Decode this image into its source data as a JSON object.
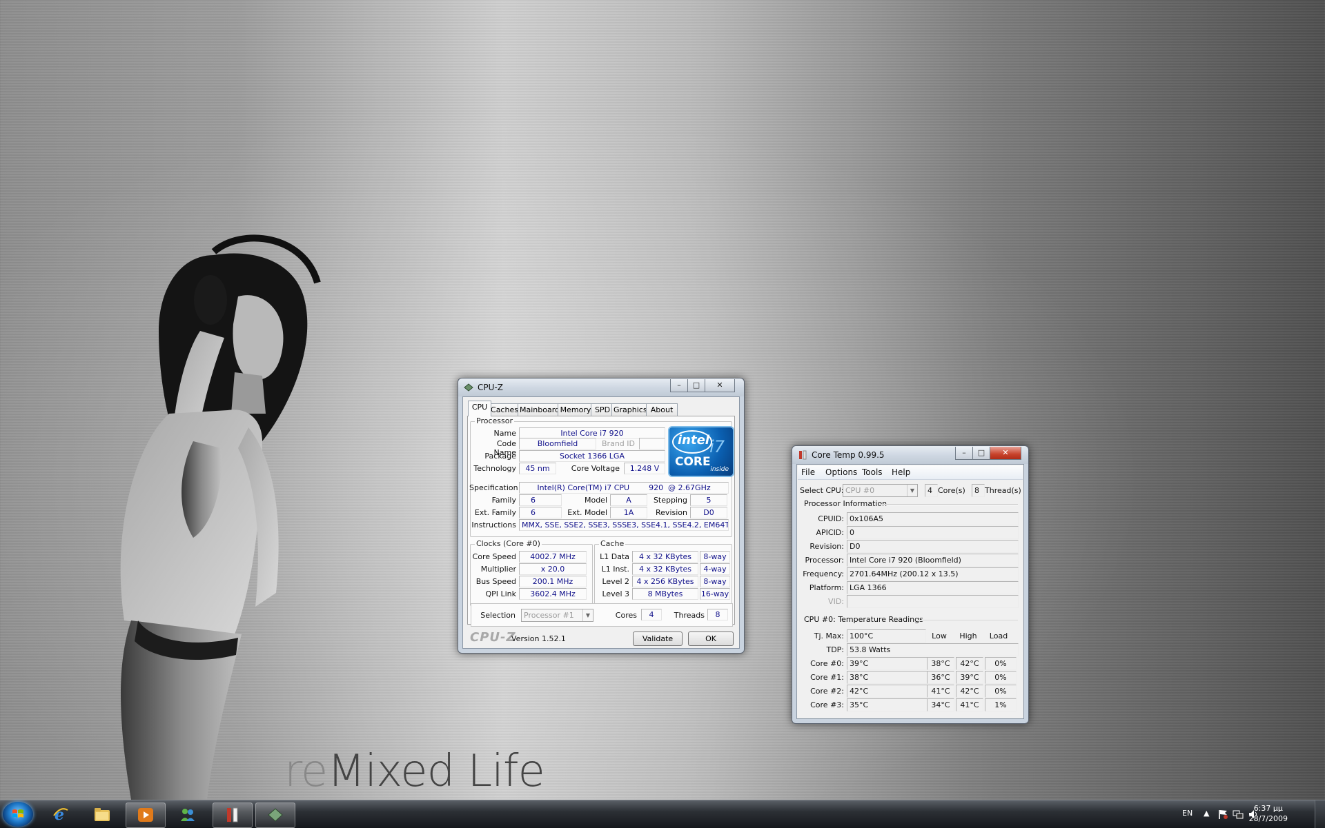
{
  "wallpaper": {
    "text_re": "re",
    "text_rest": "Mixed Life"
  },
  "cpuz": {
    "title": "CPU-Z",
    "tabs": [
      "CPU",
      "Caches",
      "Mainboard",
      "Memory",
      "SPD",
      "Graphics",
      "About"
    ],
    "processor": {
      "group": "Processor",
      "name_label": "Name",
      "name": "Intel Core i7 920",
      "codename_label": "Code Name",
      "codename": "Bloomfield",
      "brandid_label": "Brand ID",
      "brandid": "",
      "package_label": "Package",
      "package": "Socket 1366 LGA",
      "technology_label": "Technology",
      "technology": "45 nm",
      "voltage_label": "Core Voltage",
      "voltage": "1.248 V",
      "spec_label": "Specification",
      "spec": "Intel(R) Core(TM) i7 CPU        920  @ 2.67GHz",
      "family_label": "Family",
      "family": "6",
      "model_label": "Model",
      "model": "A",
      "stepping_label": "Stepping",
      "stepping": "5",
      "extfamily_label": "Ext. Family",
      "extfamily": "6",
      "extmodel_label": "Ext. Model",
      "extmodel": "1A",
      "revision_label": "Revision",
      "revision": "D0",
      "instructions_label": "Instructions",
      "instructions": "MMX, SSE, SSE2, SSE3, SSSE3, SSE4.1, SSE4.2, EM64T"
    },
    "logo": {
      "intel": "intel",
      "core": "CORE",
      "i7": "i7",
      "inside": "inside"
    },
    "clocks": {
      "group": "Clocks (Core #0)",
      "core_speed_label": "Core Speed",
      "core_speed": "4002.7 MHz",
      "multiplier_label": "Multiplier",
      "multiplier": "x 20.0",
      "bus_speed_label": "Bus Speed",
      "bus_speed": "200.1 MHz",
      "qpi_label": "QPI Link",
      "qpi": "3602.4 MHz"
    },
    "cache": {
      "group": "Cache",
      "rows": [
        {
          "label": "L1 Data",
          "size": "4 x 32 KBytes",
          "way": "8-way"
        },
        {
          "label": "L1 Inst.",
          "size": "4 x 32 KBytes",
          "way": "4-way"
        },
        {
          "label": "Level 2",
          "size": "4 x 256 KBytes",
          "way": "8-way"
        },
        {
          "label": "Level 3",
          "size": "8 MBytes",
          "way": "16-way"
        }
      ]
    },
    "selection": {
      "label": "Selection",
      "value": "Processor #1",
      "cores_label": "Cores",
      "cores": "4",
      "threads_label": "Threads",
      "threads": "8"
    },
    "footer": {
      "brand": "CPU-Z",
      "version": "Version 1.52.1",
      "validate": "Validate",
      "ok": "OK"
    }
  },
  "coretemp": {
    "title": "Core Temp 0.99.5",
    "menu": [
      "File",
      "Options",
      "Tools",
      "Help"
    ],
    "select_cpu_label": "Select CPU:",
    "select_cpu": "CPU #0",
    "cores": "4",
    "cores_label": "Core(s)",
    "threads": "8",
    "threads_label": "Thread(s)",
    "info_title": "Processor Information",
    "info": [
      {
        "label": "CPUID:",
        "value": "0x106A5"
      },
      {
        "label": "APICID:",
        "value": "0"
      },
      {
        "label": "Revision:",
        "value": "D0"
      },
      {
        "label": "Processor:",
        "value": "Intel Core i7 920 (Bloomfield)"
      },
      {
        "label": "Frequency:",
        "value": "2701.64MHz (200.12 x 13.5)"
      },
      {
        "label": "Platform:",
        "value": "LGA 1366"
      },
      {
        "label": "VID:",
        "value": ""
      }
    ],
    "temps_title": "CPU #0: Temperature Readings",
    "tjmax_label": "Tj. Max:",
    "tjmax": "100°C",
    "tdp_label": "TDP:",
    "tdp": "53.8 Watts",
    "col_low": "Low",
    "col_high": "High",
    "col_load": "Load",
    "cores_list": [
      {
        "label": "Core #0:",
        "temp": "39°C",
        "low": "38°C",
        "high": "42°C",
        "load": "0%"
      },
      {
        "label": "Core #1:",
        "temp": "38°C",
        "low": "36°C",
        "high": "39°C",
        "load": "0%"
      },
      {
        "label": "Core #2:",
        "temp": "42°C",
        "low": "41°C",
        "high": "42°C",
        "load": "0%"
      },
      {
        "label": "Core #3:",
        "temp": "35°C",
        "low": "34°C",
        "high": "41°C",
        "load": "1%"
      }
    ]
  },
  "taskbar": {
    "apps": [
      "internet-explorer",
      "windows-explorer",
      "media-player",
      "windows-live-messenger",
      "core-temp",
      "cpu-z"
    ],
    "lang": "EN",
    "time": "6:37 μμ",
    "date": "28/7/2009"
  }
}
